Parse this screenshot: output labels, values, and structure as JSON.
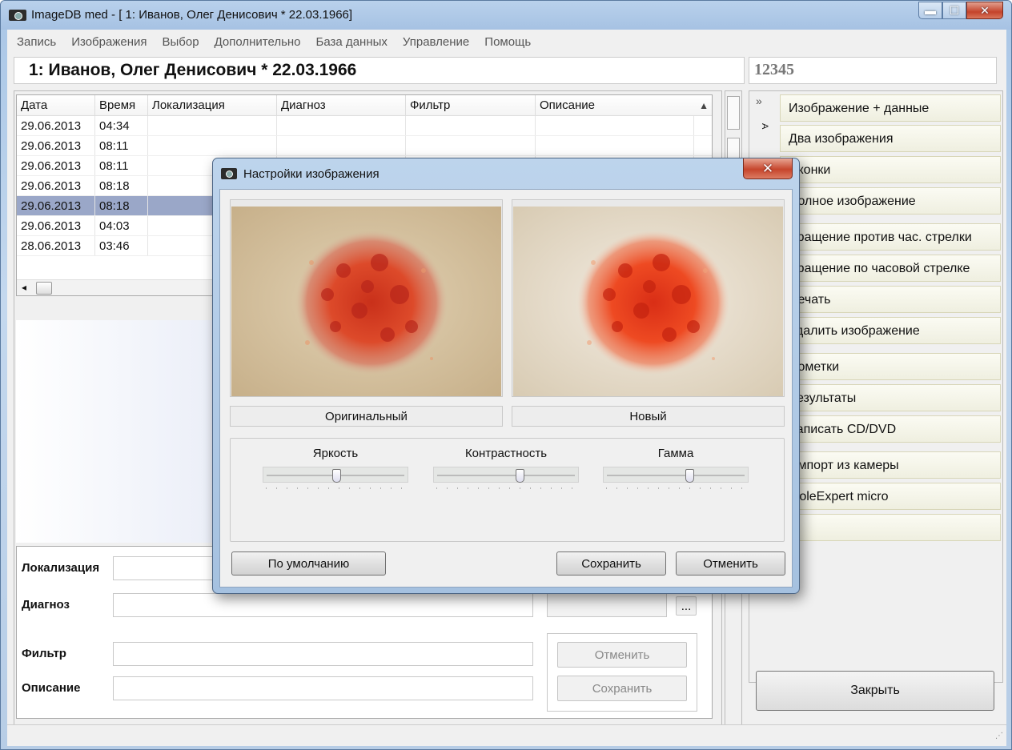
{
  "window": {
    "title": "ImageDB med - [  1: Иванов, Олег Денисович   * 22.03.1966]",
    "min": "▬",
    "max": "☐",
    "close": "✕"
  },
  "menu": [
    "Запись",
    "Изображения",
    "Выбор",
    "Дополнительно",
    "База данных",
    "Управление",
    "Помощь"
  ],
  "header": {
    "patient": "1: Иванов, Олег Денисович   * 22.03.1966",
    "id": "12345"
  },
  "table": {
    "columns": [
      "Дата",
      "Время",
      "Локализация",
      "Диагноз",
      "Фильтр",
      "Описание"
    ],
    "rows": [
      {
        "date": "29.06.2013",
        "time": "04:34"
      },
      {
        "date": "29.06.2013",
        "time": "08:11"
      },
      {
        "date": "29.06.2013",
        "time": "08:11"
      },
      {
        "date": "29.06.2013",
        "time": "08:18"
      },
      {
        "date": "29.06.2013",
        "time": "08:18"
      },
      {
        "date": "29.06.2013",
        "time": "04:03"
      },
      {
        "date": "28.06.2013",
        "time": "03:46"
      }
    ],
    "selected_row": 4,
    "sort_arrow": "▲",
    "scroll_left": "◂"
  },
  "form": {
    "localization_label": "Локализация",
    "diagnosis_label": "Диагноз",
    "filter_label": "Фильтр",
    "description_label": "Описание",
    "browse_label": "...",
    "cancel_label": "Отменить",
    "save_label": "Сохранить"
  },
  "right_panel": {
    "collapse": "»",
    "vertical_tab": "А",
    "buttons": [
      "Изображение + данные",
      "Два изображения",
      "Иконки",
      "Полное изображение",
      "Вращение против час. стрелки",
      "Вращение по часовой стрелке",
      "Печать",
      "Удалить изображение",
      "Пометки",
      "Результаты",
      "Записать CD/DVD",
      "Импорт из камеры",
      "MoleExpert micro",
      ""
    ],
    "close_label": "Закрыть"
  },
  "dialog": {
    "title": "Настройки изображения",
    "close": "✕",
    "original_caption": "Оригинальный",
    "new_caption": "Новый",
    "brightness_label": "Яркость",
    "contrast_label": "Контрастность",
    "gamma_label": "Гамма",
    "brightness_level": 0.5,
    "contrast_level": 0.6,
    "gamma_level": 0.6,
    "default_label": "По умолчанию",
    "save_label": "Сохранить",
    "cancel_label": "Отменить"
  },
  "status": {
    "grip": "⋰"
  }
}
